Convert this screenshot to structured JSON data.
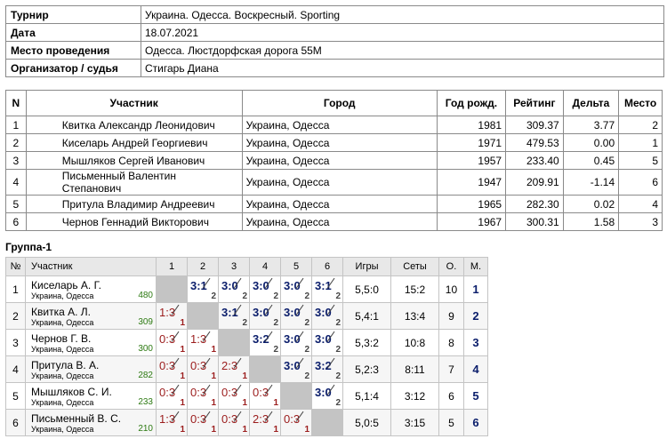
{
  "info": [
    {
      "key": "Турнир",
      "value": "Украина. Одесса. Воскресный. Sporting"
    },
    {
      "key": "Дата",
      "value": "18.07.2021"
    },
    {
      "key": "Место проведения",
      "value": "Одесса. Люстдорфская дорога 55М"
    },
    {
      "key": "Организатор / судья",
      "value": "Стигарь Диана"
    }
  ],
  "participants": {
    "headers": [
      "N",
      "Участник",
      "Город",
      "Год рожд.",
      "Рейтинг",
      "Дельта",
      "Место"
    ],
    "rows": [
      [
        "1",
        "Квитка Александр Леонидович",
        "Украина, Одесса",
        "1981",
        "309.37",
        "3.77",
        "2"
      ],
      [
        "2",
        "Киселарь Андрей Георгиевич",
        "Украина, Одесса",
        "1971",
        "479.53",
        "0.00",
        "1"
      ],
      [
        "3",
        "Мышляков Сергей Иванович",
        "Украина, Одесса",
        "1957",
        "233.40",
        "0.45",
        "5"
      ],
      [
        "4",
        "Письменный Валентин Степанович",
        "Украина, Одесса",
        "1947",
        "209.91",
        "-1.14",
        "6"
      ],
      [
        "5",
        "Притула Владимир Андреевич",
        "Украина, Одесса",
        "1965",
        "282.30",
        "0.02",
        "4"
      ],
      [
        "6",
        "Чернов Геннадий Викторович",
        "Украина, Одесса",
        "1967",
        "300.31",
        "1.58",
        "3"
      ]
    ]
  },
  "group": {
    "title": "Группа-1",
    "headers": [
      "№",
      "Участник",
      "1",
      "2",
      "3",
      "4",
      "5",
      "6",
      "Игры",
      "Сеты",
      "О.",
      "М."
    ],
    "rows": [
      {
        "n": "1",
        "name": "Киселарь А. Г.",
        "city": "Украина, Одесса",
        "rating": "480",
        "results": [
          null,
          {
            "s": "3:1",
            "p": "2"
          },
          {
            "s": "3:0",
            "p": "2"
          },
          {
            "s": "3:0",
            "p": "2"
          },
          {
            "s": "3:0",
            "p": "2"
          },
          {
            "s": "3:1",
            "p": "2"
          }
        ],
        "games": "5,5:0",
        "sets": "15:2",
        "points": "10",
        "place": "1"
      },
      {
        "n": "2",
        "name": "Квитка А. Л.",
        "city": "Украина, Одесса",
        "rating": "309",
        "results": [
          {
            "s": "1:3",
            "p": "1"
          },
          null,
          {
            "s": "3:1",
            "p": "2"
          },
          {
            "s": "3:0",
            "p": "2"
          },
          {
            "s": "3:0",
            "p": "2"
          },
          {
            "s": "3:0",
            "p": "2"
          }
        ],
        "games": "5,4:1",
        "sets": "13:4",
        "points": "9",
        "place": "2"
      },
      {
        "n": "3",
        "name": "Чернов Г. В.",
        "city": "Украина, Одесса",
        "rating": "300",
        "results": [
          {
            "s": "0:3",
            "p": "1"
          },
          {
            "s": "1:3",
            "p": "1"
          },
          null,
          {
            "s": "3:2",
            "p": "2"
          },
          {
            "s": "3:0",
            "p": "2"
          },
          {
            "s": "3:0",
            "p": "2"
          }
        ],
        "games": "5,3:2",
        "sets": "10:8",
        "points": "8",
        "place": "3"
      },
      {
        "n": "4",
        "name": "Притула В. А.",
        "city": "Украина, Одесса",
        "rating": "282",
        "results": [
          {
            "s": "0:3",
            "p": "1"
          },
          {
            "s": "0:3",
            "p": "1"
          },
          {
            "s": "2:3",
            "p": "1"
          },
          null,
          {
            "s": "3:0",
            "p": "2"
          },
          {
            "s": "3:2",
            "p": "2"
          }
        ],
        "games": "5,2:3",
        "sets": "8:11",
        "points": "7",
        "place": "4"
      },
      {
        "n": "5",
        "name": "Мышляков С. И.",
        "city": "Украина, Одесса",
        "rating": "233",
        "results": [
          {
            "s": "0:3",
            "p": "1"
          },
          {
            "s": "0:3",
            "p": "1"
          },
          {
            "s": "0:3",
            "p": "1"
          },
          {
            "s": "0:3",
            "p": "1"
          },
          null,
          {
            "s": "3:0",
            "p": "2"
          }
        ],
        "games": "5,1:4",
        "sets": "3:12",
        "points": "6",
        "place": "5"
      },
      {
        "n": "6",
        "name": "Письменный В. С.",
        "city": "Украина, Одесса",
        "rating": "210",
        "results": [
          {
            "s": "1:3",
            "p": "1"
          },
          {
            "s": "0:3",
            "p": "1"
          },
          {
            "s": "0:3",
            "p": "1"
          },
          {
            "s": "2:3",
            "p": "1"
          },
          {
            "s": "0:3",
            "p": "1"
          },
          null
        ],
        "games": "5,0:5",
        "sets": "3:15",
        "points": "5",
        "place": "6"
      }
    ]
  },
  "colors": {
    "win": "#0a1d6b",
    "loss": "#9b1c1c",
    "rating": "#2d7a12",
    "diagonal": "#c4c4c4",
    "header_bg": "#e8e8e8"
  }
}
